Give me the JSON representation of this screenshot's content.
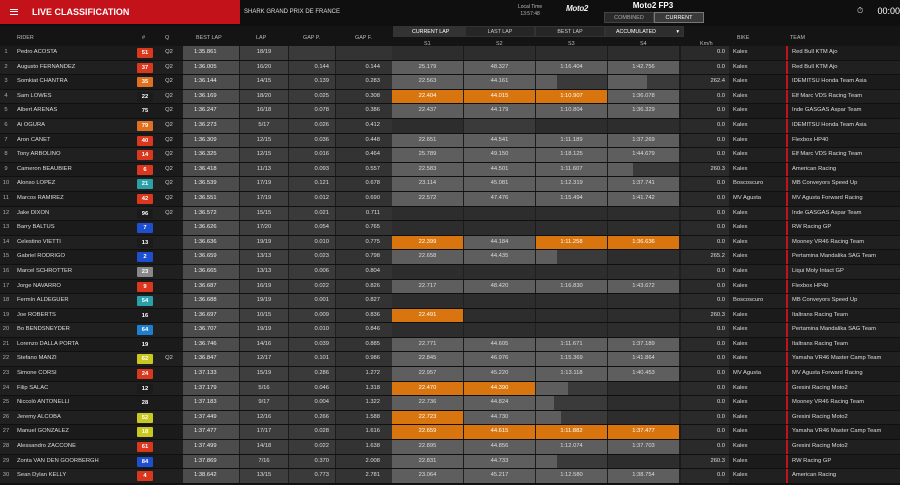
{
  "header": {
    "title": "LIVE CLASSIFICATION",
    "gp": "SHARK GRAND PRIX DE FRANCE",
    "local_time_label": "Local Time",
    "local_time": "13:57:48",
    "logo": "Moto2",
    "session": "Moto2 FP3",
    "views": [
      "COMBINED",
      "CURRENT"
    ],
    "clock": "00:00"
  },
  "subheader": {
    "current_lap": "CURRENT LAP",
    "last_lap": "LAST LAP",
    "best_lap": "BEST LAP",
    "mode": "ACCUMULATED"
  },
  "columns": {
    "pos": "",
    "rider": "RIDER",
    "num": "#",
    "q": "Q",
    "best": "BEST LAP",
    "lap": "LAP",
    "gapp": "GAP P.",
    "gapf": "GAP F.",
    "s1": "S1",
    "s2": "S2",
    "s3": "S3",
    "s4": "S4",
    "kmh": "Km/h",
    "bike": "BIKE",
    "team": "TEAM"
  },
  "rows": [
    {
      "pos": "1",
      "rider": "Pedro ACOSTA",
      "num": "51",
      "numcolor": "#d9381e",
      "q": "Q2",
      "best": "1:35.861",
      "lap": "18/19",
      "gapp": "",
      "gapf": "",
      "s1": "",
      "s2": "",
      "s3": "",
      "s4": "",
      "kmh": "0.0",
      "bike": "Kalex",
      "team": "Red Bull KTM Ajo"
    },
    {
      "pos": "2",
      "rider": "Augusto FERNANDEZ",
      "num": "37",
      "numcolor": "#d9381e",
      "q": "Q2",
      "best": "1:36.005",
      "lap": "16/20",
      "gapp": "0.144",
      "gapf": "0.144",
      "s1": "25.179",
      "s2": "48.327",
      "s3": "1:16.404",
      "s4": "1:42.756",
      "kmh": "0.0",
      "bike": "Kalex",
      "team": "Red Bull KTM Ajo"
    },
    {
      "pos": "3",
      "rider": "Somkiat CHANTRA",
      "num": "35",
      "numcolor": "#e07020",
      "q": "Q2",
      "best": "1:36.144",
      "lap": "14/15",
      "gapp": "0.139",
      "gapf": "0.283",
      "s1": "22.563",
      "s2": "44.161",
      "s3": "",
      "s4": "",
      "kmh": "262.4",
      "bike": "Kalex",
      "team": "IDEMITSU Honda Team Asia"
    },
    {
      "pos": "4",
      "rider": "Sam LOWES",
      "num": "22",
      "numcolor": "#1b1b1b",
      "q": "Q2",
      "best": "1:36.169",
      "lap": "18/20",
      "gapp": "0.025",
      "gapf": "0.308",
      "s1": "22.404",
      "s2": "44.015",
      "s3": "1:10.907",
      "s4": "1:36.078",
      "kmh": "0.0",
      "bike": "Kalex",
      "team": "Elf Marc VDS Racing Team"
    },
    {
      "pos": "5",
      "rider": "Albert ARENAS",
      "num": "75",
      "numcolor": "#1b1b1b",
      "q": "Q2",
      "best": "1:36.247",
      "lap": "16/18",
      "gapp": "0.078",
      "gapf": "0.386",
      "s1": "22.437",
      "s2": "44.179",
      "s3": "1:10.804",
      "s4": "1:36.329",
      "kmh": "0.0",
      "bike": "Kalex",
      "team": "Inde GASGAS Aspar Team"
    },
    {
      "pos": "6",
      "rider": "Ai OGURA",
      "num": "79",
      "numcolor": "#e07020",
      "q": "Q2",
      "best": "1:36.273",
      "lap": "5/17",
      "gapp": "0.026",
      "gapf": "0.412",
      "s1": "",
      "s2": "",
      "s3": "",
      "s4": "",
      "kmh": "0.0",
      "bike": "Kalex",
      "team": "IDEMITSU Honda Team Asia"
    },
    {
      "pos": "7",
      "rider": "Aron CANET",
      "num": "40",
      "numcolor": "#d9381e",
      "q": "Q2",
      "best": "1:36.309",
      "lap": "12/15",
      "gapp": "0.036",
      "gapf": "0.448",
      "s1": "22.651",
      "s2": "44.541",
      "s3": "1:11.189",
      "s4": "1:37.269",
      "kmh": "0.0",
      "bike": "Kalex",
      "team": "Flexbox HP40"
    },
    {
      "pos": "8",
      "rider": "Tony ARBOLINO",
      "num": "14",
      "numcolor": "#d9381e",
      "q": "Q2",
      "best": "1:36.325",
      "lap": "12/15",
      "gapp": "0.016",
      "gapf": "0.464",
      "s1": "25.789",
      "s2": "49.150",
      "s3": "1:18.125",
      "s4": "1:44.679",
      "kmh": "0.0",
      "bike": "Kalex",
      "team": "Elf Marc VDS Racing Team"
    },
    {
      "pos": "9",
      "rider": "Cameron BEAUBIER",
      "num": "6",
      "numcolor": "#d9381e",
      "q": "Q2",
      "best": "1:36.418",
      "lap": "11/13",
      "gapp": "0.093",
      "gapf": "0.557",
      "s1": "22.583",
      "s2": "44.501",
      "s3": "1:11.607",
      "s4": "",
      "kmh": "260.3",
      "bike": "Kalex",
      "team": "American Racing"
    },
    {
      "pos": "10",
      "rider": "Alonso LOPEZ",
      "num": "21",
      "numcolor": "#2aa0a8",
      "q": "Q2",
      "best": "1:36.539",
      "lap": "17/19",
      "gapp": "0.121",
      "gapf": "0.678",
      "s1": "23.114",
      "s2": "45.081",
      "s3": "1:12.319",
      "s4": "1:37.741",
      "kmh": "0.0",
      "bike": "Boscoscuro",
      "team": "MB Conveyors Speed Up"
    },
    {
      "pos": "11",
      "rider": "Marcos RAMIREZ",
      "num": "42",
      "numcolor": "#d9381e",
      "q": "Q2",
      "best": "1:36.551",
      "lap": "17/19",
      "gapp": "0.012",
      "gapf": "0.690",
      "s1": "22.572",
      "s2": "47.476",
      "s3": "1:15.494",
      "s4": "1:41.742",
      "kmh": "0.0",
      "bike": "MV Agusta",
      "team": "MV Agusta Forward Racing"
    },
    {
      "pos": "12",
      "rider": "Jake DIXON",
      "num": "96",
      "numcolor": "#1b1b1b",
      "q": "Q2",
      "best": "1:36.572",
      "lap": "15/15",
      "gapp": "0.021",
      "gapf": "0.711",
      "s1": "",
      "s2": "",
      "s3": "",
      "s4": "",
      "kmh": "0.0",
      "bike": "Kalex",
      "team": "Inde GASGAS Aspar Team"
    },
    {
      "pos": "13",
      "rider": "Barry BALTUS",
      "num": "7",
      "numcolor": "#1e4fd0",
      "q": "",
      "best": "1:36.626",
      "lap": "17/20",
      "gapp": "0.054",
      "gapf": "0.765",
      "s1": "",
      "s2": "",
      "s3": "",
      "s4": "",
      "kmh": "0.0",
      "bike": "Kalex",
      "team": "RW Racing GP"
    },
    {
      "pos": "14",
      "rider": "Celestino VIETTI",
      "num": "13",
      "numcolor": "#1b1b1b",
      "q": "",
      "best": "1:36.636",
      "lap": "19/19",
      "gapp": "0.010",
      "gapf": "0.775",
      "s1": "22.399",
      "s2": "44.184",
      "s3": "1:11.258",
      "s4": "1:36.636",
      "kmh": "0.0",
      "bike": "Kalex",
      "team": "Mooney VR46 Racing Team"
    },
    {
      "pos": "15",
      "rider": "Gabriel RODRIGO",
      "num": "2",
      "numcolor": "#1e4fd0",
      "q": "",
      "best": "1:36.659",
      "lap": "13/13",
      "gapp": "0.023",
      "gapf": "0.798",
      "s1": "22.658",
      "s2": "44.435",
      "s3": "",
      "s4": "",
      "kmh": "265.2",
      "bike": "Kalex",
      "team": "Pertamina Mandalika SAG Team"
    },
    {
      "pos": "16",
      "rider": "Marcel SCHROTTER",
      "num": "23",
      "numcolor": "#888888",
      "q": "",
      "best": "1:36.665",
      "lap": "13/13",
      "gapp": "0.006",
      "gapf": "0.804",
      "s1": "",
      "s2": "",
      "s3": "",
      "s4": "",
      "kmh": "0.0",
      "bike": "Kalex",
      "team": "Liqui Moly Intact GP"
    },
    {
      "pos": "17",
      "rider": "Jorge NAVARRO",
      "num": "9",
      "numcolor": "#d9381e",
      "q": "",
      "best": "1:36.687",
      "lap": "16/19",
      "gapp": "0.022",
      "gapf": "0.826",
      "s1": "22.717",
      "s2": "48.420",
      "s3": "1:16.830",
      "s4": "1:43.672",
      "kmh": "0.0",
      "bike": "Kalex",
      "team": "Flexbox HP40"
    },
    {
      "pos": "18",
      "rider": "Fermín ALDEGUER",
      "num": "54",
      "numcolor": "#2aa0a8",
      "q": "",
      "best": "1:36.688",
      "lap": "19/19",
      "gapp": "0.001",
      "gapf": "0.827",
      "s1": "",
      "s2": "",
      "s3": "",
      "s4": "",
      "kmh": "0.0",
      "bike": "Boscoscuro",
      "team": "MB Conveyors Speed Up"
    },
    {
      "pos": "19",
      "rider": "Joe ROBERTS",
      "num": "16",
      "numcolor": "#1b1b1b",
      "q": "",
      "best": "1:36.697",
      "lap": "10/15",
      "gapp": "0.009",
      "gapf": "0.836",
      "s1": "22.491",
      "s2": "",
      "s3": "",
      "s4": "",
      "kmh": "260.3",
      "bike": "Kalex",
      "team": "Italtrans Racing Team"
    },
    {
      "pos": "20",
      "rider": "Bo BENDSNEYDER",
      "num": "64",
      "numcolor": "#1e7fd0",
      "q": "",
      "best": "1:36.707",
      "lap": "19/19",
      "gapp": "0.010",
      "gapf": "0.846",
      "s1": "",
      "s2": "",
      "s3": "",
      "s4": "",
      "kmh": "0.0",
      "bike": "Kalex",
      "team": "Pertamina Mandalika SAG Team"
    },
    {
      "pos": "21",
      "rider": "Lorenzo DALLA PORTA",
      "num": "19",
      "numcolor": "#1b1b1b",
      "q": "",
      "best": "1:36.746",
      "lap": "14/16",
      "gapp": "0.039",
      "gapf": "0.885",
      "s1": "22.771",
      "s2": "44.605",
      "s3": "1:11.671",
      "s4": "1:37.189",
      "kmh": "0.0",
      "bike": "Kalex",
      "team": "Italtrans Racing Team"
    },
    {
      "pos": "22",
      "rider": "Stefano MANZI",
      "num": "62",
      "numcolor": "#c8c820",
      "q": "Q2",
      "best": "1:36.847",
      "lap": "12/17",
      "gapp": "0.101",
      "gapf": "0.986",
      "s1": "22.845",
      "s2": "46.976",
      "s3": "1:15.369",
      "s4": "1:41.864",
      "kmh": "0.0",
      "bike": "Kalex",
      "team": "Yamaha VR46 Master Camp Team"
    },
    {
      "pos": "23",
      "rider": "Simone CORSI",
      "num": "24",
      "numcolor": "#d9381e",
      "q": "",
      "best": "1:37.133",
      "lap": "15/19",
      "gapp": "0.286",
      "gapf": "1.272",
      "s1": "22.957",
      "s2": "45.220",
      "s3": "1:13.118",
      "s4": "1:40.453",
      "kmh": "0.0",
      "bike": "MV Agusta",
      "team": "MV Agusta Forward Racing"
    },
    {
      "pos": "24",
      "rider": "Filip SALAC",
      "num": "12",
      "numcolor": "#1b1b1b",
      "q": "",
      "best": "1:37.179",
      "lap": "5/16",
      "gapp": "0.046",
      "gapf": "1.318",
      "s1": "22.470",
      "s2": "44.390",
      "s3": "",
      "s4": "",
      "kmh": "0.0",
      "bike": "Kalex",
      "team": "Gresini Racing Moto2"
    },
    {
      "pos": "25",
      "rider": "Niccolò ANTONELLI",
      "num": "28",
      "numcolor": "#1b1b1b",
      "q": "",
      "best": "1:37.183",
      "lap": "9/17",
      "gapp": "0.004",
      "gapf": "1.322",
      "s1": "22.736",
      "s2": "44.824",
      "s3": "",
      "s4": "",
      "kmh": "0.0",
      "bike": "Kalex",
      "team": "Mooney VR46 Racing Team"
    },
    {
      "pos": "26",
      "rider": "Jeremy ALCOBA",
      "num": "52",
      "numcolor": "#c8c820",
      "q": "",
      "best": "1:37.449",
      "lap": "12/16",
      "gapp": "0.266",
      "gapf": "1.588",
      "s1": "22.723",
      "s2": "44.730",
      "s3": "",
      "s4": "",
      "kmh": "0.0",
      "bike": "Kalex",
      "team": "Gresini Racing Moto2"
    },
    {
      "pos": "27",
      "rider": "Manuel GONZALEZ",
      "num": "18",
      "numcolor": "#c8c820",
      "q": "",
      "best": "1:37.477",
      "lap": "17/17",
      "gapp": "0.028",
      "gapf": "1.616",
      "s1": "22.659",
      "s2": "44.615",
      "s3": "1:11.882",
      "s4": "1:37.477",
      "kmh": "0.0",
      "bike": "Kalex",
      "team": "Yamaha VR46 Master Camp Team"
    },
    {
      "pos": "28",
      "rider": "Alessandro ZACCONE",
      "num": "61",
      "numcolor": "#d9381e",
      "q": "",
      "best": "1:37.499",
      "lap": "14/18",
      "gapp": "0.022",
      "gapf": "1.638",
      "s1": "22.895",
      "s2": "44.856",
      "s3": "1:12.074",
      "s4": "1:37.703",
      "kmh": "0.0",
      "bike": "Kalex",
      "team": "Gresini Racing Moto2"
    },
    {
      "pos": "29",
      "rider": "Zonta VAN DEN GOORBERGH",
      "num": "84",
      "numcolor": "#1e4fd0",
      "q": "",
      "best": "1:37.869",
      "lap": "7/16",
      "gapp": "0.370",
      "gapf": "2.008",
      "s1": "22.831",
      "s2": "44.733",
      "s3": "",
      "s4": "",
      "kmh": "260.3",
      "bike": "Kalex",
      "team": "RW Racing GP"
    },
    {
      "pos": "30",
      "rider": "Sean Dylan KELLY",
      "num": "4",
      "numcolor": "#d9381e",
      "q": "",
      "best": "1:38.642",
      "lap": "13/15",
      "gapp": "0.773",
      "gapf": "2.781",
      "s1": "23.064",
      "s2": "45.217",
      "s3": "1:12.580",
      "s4": "1:38.754",
      "kmh": "0.0",
      "bike": "Kalex",
      "team": "American Racing"
    }
  ],
  "orange_cells": {
    "4": [
      "s1",
      "s2",
      "s3"
    ],
    "14": [
      "s1",
      "s3",
      "s4"
    ],
    "19": [
      "s1"
    ],
    "24": [
      "s1",
      "s2"
    ],
    "26": [
      "s1"
    ],
    "27": [
      "s1",
      "s2",
      "s3",
      "s4"
    ]
  },
  "partial_cells": {
    "3": {
      "s3": 0.3,
      "s4": 0.55
    },
    "6": {
      "s2": 0.0
    },
    "9": {
      "s4": 0.35
    },
    "15": {
      "s3": 0.3
    },
    "24": {
      "s3": 0.45
    },
    "25": {
      "s3": 0.25
    },
    "26": {
      "s3": 0.35
    },
    "29": {
      "s3": 0.3
    }
  },
  "colors": {
    "accent": "#c4121a",
    "orange": "#d9750e",
    "grey_cell": "#5e5e5e"
  }
}
